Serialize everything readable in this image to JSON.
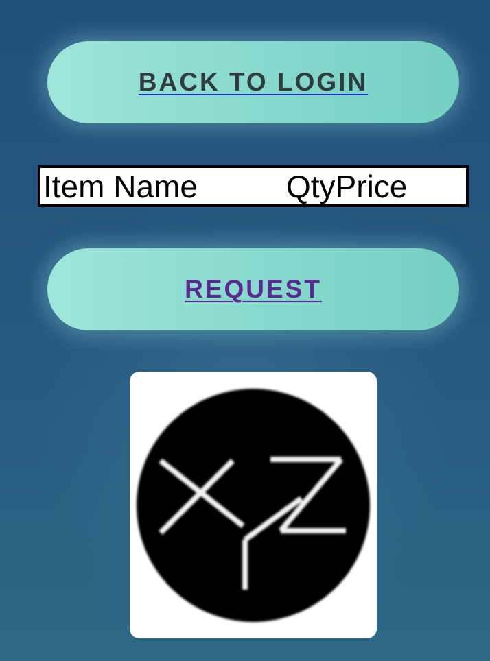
{
  "buttons": {
    "back_to_login": "BACK TO LOGIN",
    "request": "REQUEST"
  },
  "table": {
    "headers": [
      "Item Name",
      "Qty",
      "Price"
    ]
  },
  "logo": {
    "text": "XYZ",
    "icon": "xyz-logo-icon"
  },
  "colors": {
    "background": "#25587f",
    "button": "#86d8cc",
    "back_link": "#2f3b3d",
    "request_link": "#5b2a91"
  }
}
